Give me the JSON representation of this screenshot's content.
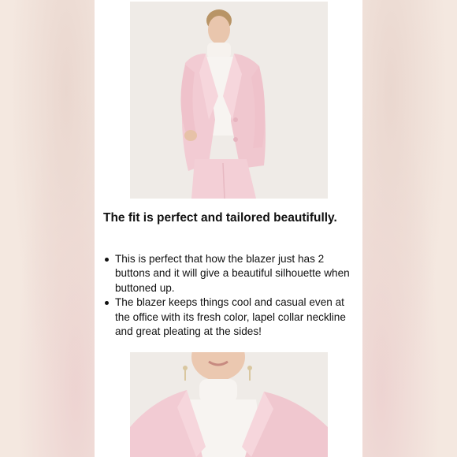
{
  "content": {
    "headline": "The fit is perfect and tailored beautifully.",
    "bullets": [
      "This is perfect that how the blazer just has 2 buttons and it will give a beautiful silhouette when buttoned up.",
      "The blazer keeps things cool and casual even at the office with its fresh color, lapel collar neckline and great pleating at the sides!"
    ]
  },
  "images": {
    "top": "model-in-pink-blazer-full-photo",
    "bottom": "pink-blazer-collar-closeup-photo"
  },
  "colors": {
    "blazer_pink": "#f2cdd4",
    "background": "#f7efe9",
    "text": "#111111"
  }
}
